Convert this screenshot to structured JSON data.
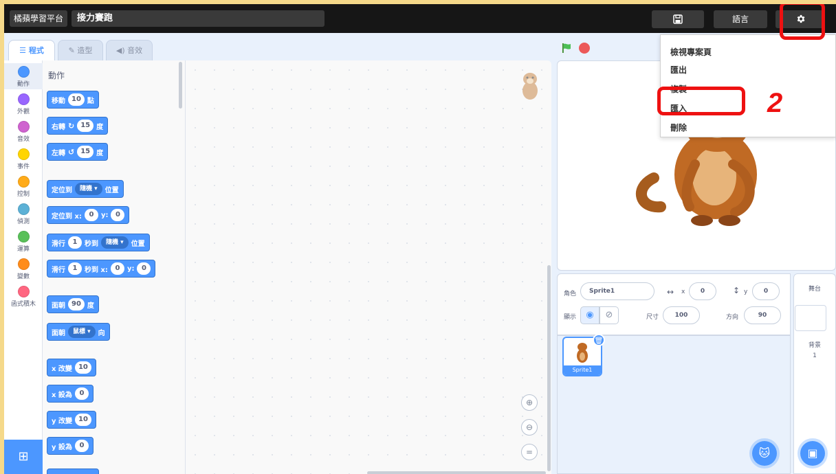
{
  "header": {
    "brand": "橘蘋學習平台",
    "project_title": "接力賽跑",
    "save_icon": "floppy-disk-icon",
    "language_label": "語言",
    "settings_icon": "gear-icon"
  },
  "tabs": [
    {
      "label": "程式",
      "icon": "code-icon"
    },
    {
      "label": "造型",
      "icon": "brush-icon"
    },
    {
      "label": "音效",
      "icon": "speaker-icon"
    }
  ],
  "categories": [
    {
      "label": "動作",
      "color": "#4c97ff"
    },
    {
      "label": "外觀",
      "color": "#9966ff"
    },
    {
      "label": "音效",
      "color": "#cf63cf"
    },
    {
      "label": "事件",
      "color": "#ffd500"
    },
    {
      "label": "控制",
      "color": "#ffab19"
    },
    {
      "label": "偵測",
      "color": "#5cb1d6"
    },
    {
      "label": "運算",
      "color": "#59c059"
    },
    {
      "label": "變數",
      "color": "#ff8c1a"
    },
    {
      "label": "函式積木",
      "color": "#ff6680"
    }
  ],
  "palette": {
    "heading": "動作",
    "blocks": {
      "move": {
        "a": "移動",
        "n": "10",
        "b": "點"
      },
      "turn_right": {
        "a": "右轉",
        "n": "15",
        "b": "度"
      },
      "turn_left": {
        "a": "左轉",
        "n": "15",
        "b": "度"
      },
      "goto": {
        "a": "定位到",
        "dd": "隨機 ▾",
        "b": "位置"
      },
      "goto_xy": {
        "a": "定位到 x:",
        "x": "0",
        "ya": "y:",
        "y": "0"
      },
      "glide": {
        "a": "滑行",
        "n": "1",
        "b": "秒到",
        "dd": "隨機 ▾",
        "c": "位置"
      },
      "glide_xy": {
        "a": "滑行",
        "n": "1",
        "b": "秒到 x:",
        "x": "0",
        "ya": "y:",
        "y": "0"
      },
      "point_dir": {
        "a": "面朝",
        "n": "90",
        "b": "度"
      },
      "point_towards": {
        "a": "面朝",
        "dd": "鼠標 ▾",
        "b": "向"
      },
      "change_x": {
        "a": "x 改變",
        "n": "10"
      },
      "set_x": {
        "a": "x 設為",
        "n": "0"
      },
      "change_y": {
        "a": "y 改變",
        "n": "10"
      },
      "set_y": {
        "a": "y 設為",
        "n": "0"
      }
    }
  },
  "menu": {
    "items": [
      "檢視專案頁",
      "匯出",
      "複製",
      "匯入",
      "刪除"
    ],
    "step_number": "2"
  },
  "sprite_info": {
    "sprite_label": "角色",
    "sprite_name": "Sprite1",
    "x_label": "x",
    "x_value": "0",
    "y_label": "y",
    "y_value": "0",
    "show_label": "顯示",
    "size_label": "尺寸",
    "size_value": "100",
    "direction_label": "方向",
    "direction_value": "90"
  },
  "sprites": [
    {
      "name": "Sprite1"
    }
  ],
  "stage_pane": {
    "title": "舞台",
    "backdrop_label": "背景",
    "backdrop_count": "1"
  },
  "colors": {
    "accent": "#4c97ff",
    "highlight": "#ee1111",
    "topbar": "#161616"
  }
}
